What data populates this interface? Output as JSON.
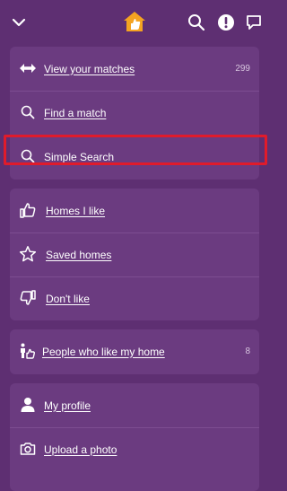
{
  "header": {
    "back_icon": "chevron-down-icon",
    "logo_icon": "house-thumbs-up-logo",
    "search_icon": "search-icon",
    "alert_icon": "exclamation-icon",
    "chat_icon": "speech-bubble-icon"
  },
  "group1": {
    "items": [
      {
        "label": "View your matches",
        "count": "299",
        "icon": "arrows-left-right-icon"
      },
      {
        "label": "Find a match",
        "icon": "search-icon"
      },
      {
        "label": "Simple Search",
        "icon": "search-icon"
      }
    ]
  },
  "group2": {
    "items": [
      {
        "label": "Homes I like",
        "icon": "thumbs-up-icon"
      },
      {
        "label": "Saved homes",
        "icon": "star-icon"
      },
      {
        "label": "Don't like",
        "icon": "thumbs-down-icon"
      }
    ]
  },
  "group3": {
    "items": [
      {
        "label": "People who like my home",
        "count": "8",
        "icon": "person-thumbs-up-icon"
      }
    ]
  },
  "group4": {
    "items": [
      {
        "label": "My profile",
        "icon": "person-icon"
      },
      {
        "label": "Upload a photo",
        "icon": "camera-icon"
      }
    ]
  },
  "colors": {
    "background": "#5e2f72",
    "card": "#6b3b80",
    "highlight": "#e01b2b",
    "logo": "#f4a321"
  }
}
